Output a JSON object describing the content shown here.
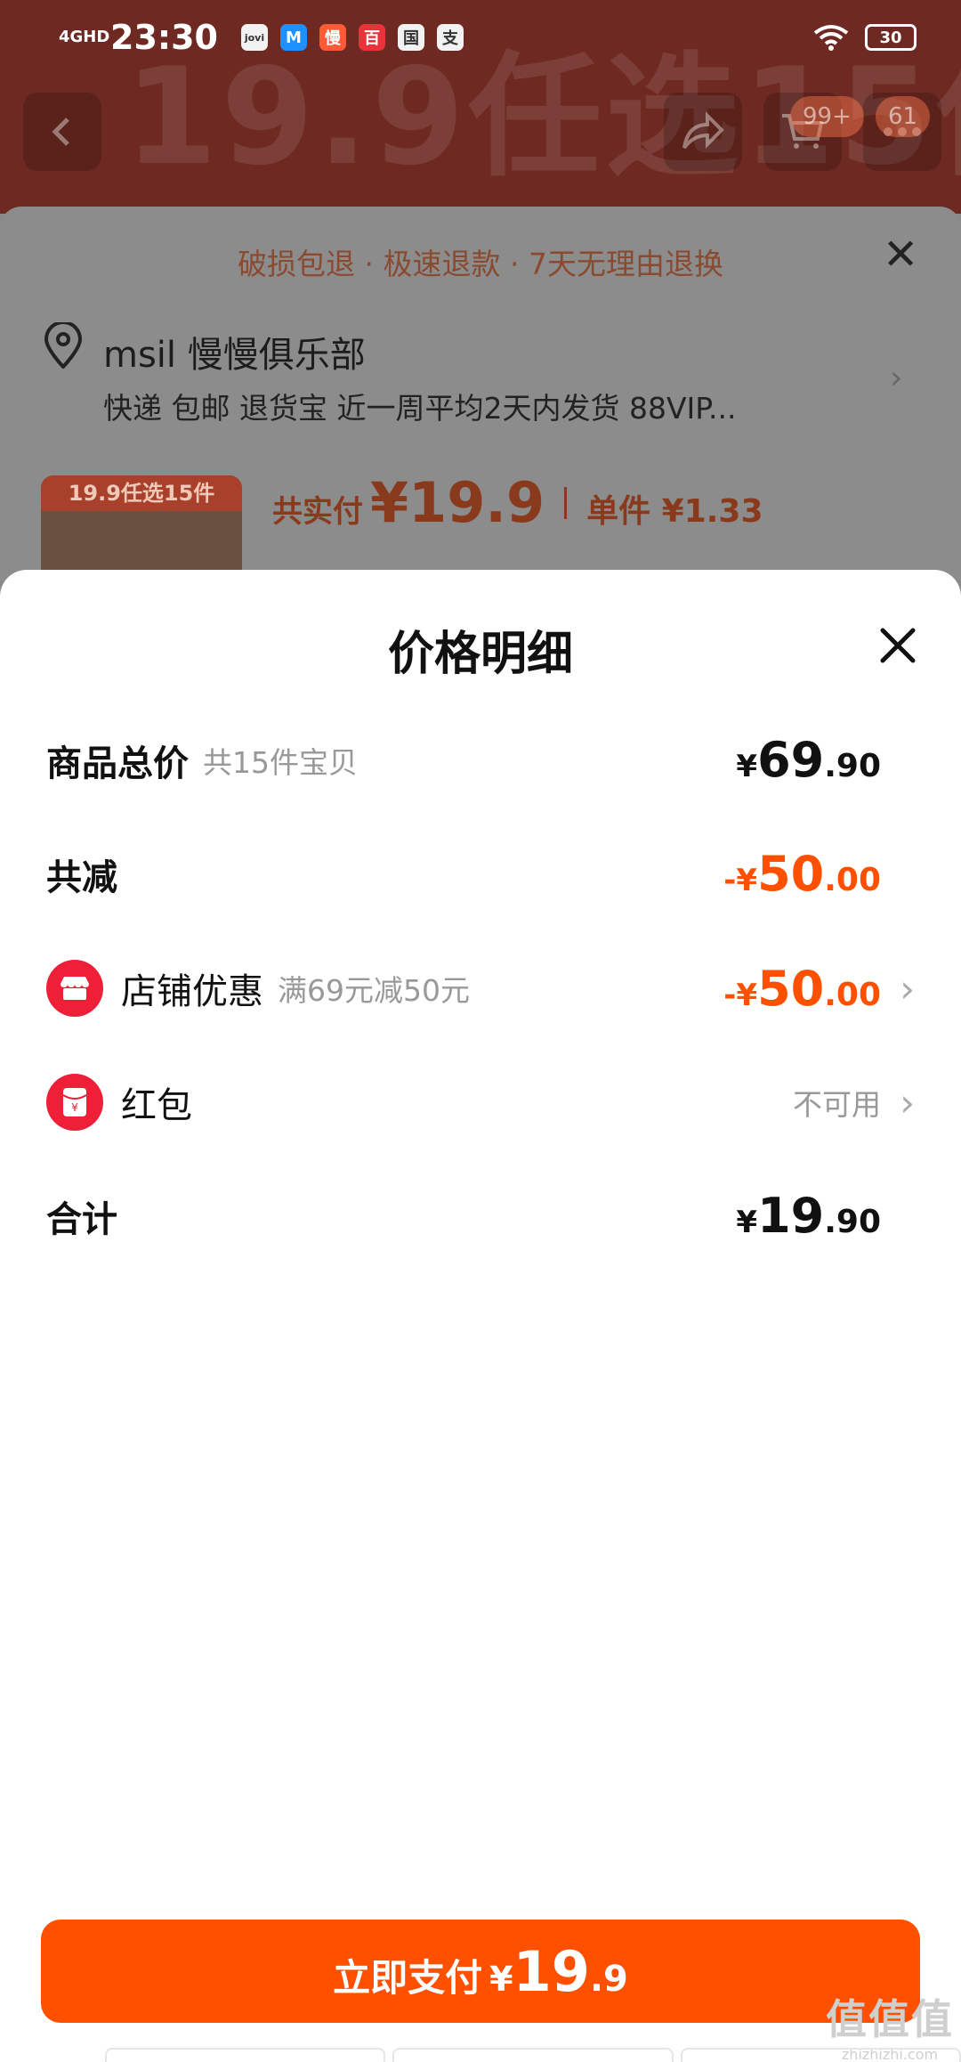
{
  "status_bar": {
    "network": "4GHD",
    "time": "23:30",
    "apps": [
      "jovi",
      "M",
      "慢",
      "百",
      "国",
      "支"
    ],
    "battery": "30"
  },
  "background": {
    "banner_text": "19.9任选15件",
    "cart_count": "99+",
    "more_count": "61",
    "guarantee": "破损包退 · 极速退款 · 7天无理由退换",
    "shop_name": "msil 慢慢俱乐部",
    "shop_meta": "快递 包邮 退货宝 近一周平均2天内发货 88VIP...",
    "thumb_label": "19.9任选15件",
    "paid_label": "共实付",
    "paid_amount": "¥19.9",
    "unit_price": "单件 ¥1.33"
  },
  "modal": {
    "title": "价格明细",
    "items_total": {
      "label": "商品总价",
      "sub": "共15件宝贝",
      "yen": "¥",
      "int": "69",
      "dec": ".90"
    },
    "discount_total": {
      "label": "共减",
      "yen": "-¥",
      "int": "50",
      "dec": ".00"
    },
    "shop_discount": {
      "label": "店铺优惠",
      "sub": "满69元减50元",
      "yen": "-¥",
      "int": "50",
      "dec": ".00"
    },
    "red_packet": {
      "label": "红包",
      "status": "不可用"
    },
    "total": {
      "label": "合计",
      "yen": "¥",
      "int": "19",
      "dec": ".90"
    }
  },
  "pay_button": {
    "label": "立即支付",
    "yen": "¥",
    "int": "19",
    "dec": ".9"
  },
  "watermark": {
    "glyph": "值值值",
    "url": "zhizhizhi.com"
  },
  "colors": {
    "accent": "#ff5000",
    "icon_red": "#ee1f36"
  }
}
